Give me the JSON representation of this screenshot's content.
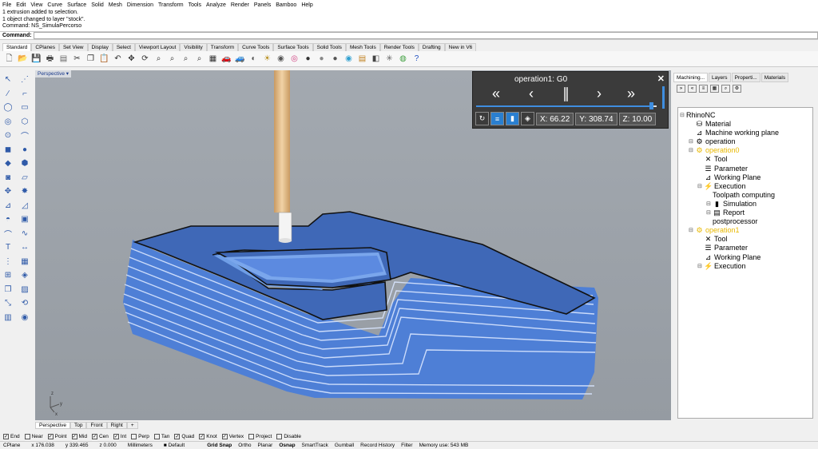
{
  "menu": [
    "File",
    "Edit",
    "View",
    "Curve",
    "Surface",
    "Solid",
    "Mesh",
    "Dimension",
    "Transform",
    "Tools",
    "Analyze",
    "Render",
    "Panels",
    "Bamboo",
    "Help"
  ],
  "history": [
    "1 extrusion added to selection.",
    "1 object changed to layer \"stock\".",
    "Command: NS_SimulaPercorso"
  ],
  "command": {
    "label": "Command:",
    "value": ""
  },
  "tabs": [
    "Standard",
    "CPlanes",
    "Set View",
    "Display",
    "Select",
    "Viewport Layout",
    "Visibility",
    "Transform",
    "Curve Tools",
    "Surface Tools",
    "Solid Tools",
    "Mesh Tools",
    "Render Tools",
    "Drafting",
    "New in V6"
  ],
  "viewport": {
    "label": "Perspective",
    "axes": {
      "x": "x",
      "y": "y",
      "z": "z"
    }
  },
  "viewtabs": [
    "Perspective",
    "Top",
    "Front",
    "Right",
    "+"
  ],
  "sim": {
    "title": "operation1: G0",
    "x": "X: 66.22",
    "y": "Y: 308.74",
    "z": "Z: 10.00",
    "progress": 0.97
  },
  "rtabs": [
    "Machining...",
    "Layers",
    "Properti...",
    "Materials"
  ],
  "tree": [
    {
      "label": "RhinoNC",
      "level": 0,
      "icon": "",
      "op": false
    },
    {
      "label": "Material",
      "level": 1,
      "icon": "material-icon",
      "op": false
    },
    {
      "label": "Machine working plane",
      "level": 1,
      "icon": "plane-icon",
      "op": false
    },
    {
      "label": "operation",
      "level": 1,
      "icon": "gear-icon",
      "op": false
    },
    {
      "label": "operation0",
      "level": 1,
      "icon": "gear-icon",
      "op": true
    },
    {
      "label": "Tool",
      "level": 2,
      "icon": "tool-icon",
      "op": false
    },
    {
      "label": "Parameter",
      "level": 2,
      "icon": "list-icon",
      "op": false
    },
    {
      "label": "Working Plane",
      "level": 2,
      "icon": "plane-icon",
      "op": false
    },
    {
      "label": "Execution",
      "level": 2,
      "icon": "execution-icon",
      "op": false
    },
    {
      "label": "Toolpath computing",
      "level": 3,
      "icon": "",
      "op": false
    },
    {
      "label": "Simulation",
      "level": 3,
      "icon": "simulation-icon",
      "op": false
    },
    {
      "label": "Report",
      "level": 3,
      "icon": "report-icon",
      "op": false
    },
    {
      "label": "postprocessor",
      "level": 3,
      "icon": "",
      "op": false
    },
    {
      "label": "operation1",
      "level": 1,
      "icon": "gear-icon",
      "op": true
    },
    {
      "label": "Tool",
      "level": 2,
      "icon": "tool-icon",
      "op": false
    },
    {
      "label": "Parameter",
      "level": 2,
      "icon": "list-icon",
      "op": false
    },
    {
      "label": "Working Plane",
      "level": 2,
      "icon": "plane-icon",
      "op": false
    },
    {
      "label": "Execution",
      "level": 2,
      "icon": "execution-icon",
      "op": false
    }
  ],
  "osnap": [
    {
      "label": "End",
      "on": true
    },
    {
      "label": "Near",
      "on": false
    },
    {
      "label": "Point",
      "on": true
    },
    {
      "label": "Mid",
      "on": true
    },
    {
      "label": "Cen",
      "on": true
    },
    {
      "label": "Int",
      "on": true
    },
    {
      "label": "Perp",
      "on": false
    },
    {
      "label": "Tan",
      "on": false
    },
    {
      "label": "Quad",
      "on": true
    },
    {
      "label": "Knot",
      "on": true
    },
    {
      "label": "Vertex",
      "on": true
    },
    {
      "label": "Project",
      "on": false
    },
    {
      "label": "Disable",
      "on": false
    }
  ],
  "status": {
    "cplane": "CPlane",
    "x": "x 176.038",
    "y": "y 339.465",
    "z": "z 0.000",
    "units": "Millimeters",
    "layer": "Default",
    "buttons": [
      "Grid Snap",
      "Ortho",
      "Planar",
      "Osnap",
      "SmartTrack",
      "Gumball",
      "Record History",
      "Filter"
    ],
    "memory": "Memory use: 543 MB"
  }
}
